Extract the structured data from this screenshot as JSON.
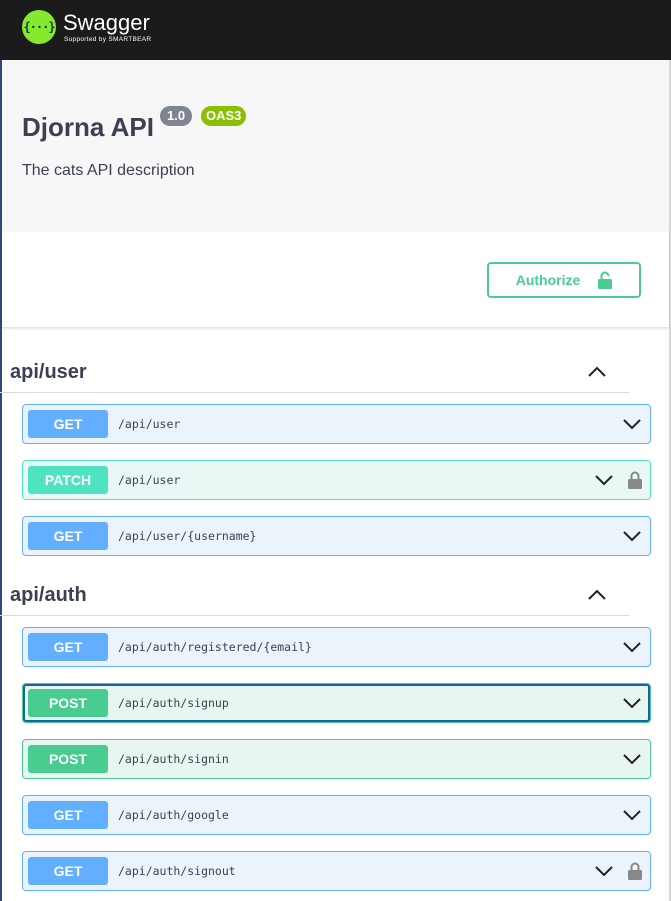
{
  "topbar": {
    "logo_glyph": "{···}",
    "logo_name": "Swagger",
    "logo_sub": "Supported by SMARTBEAR"
  },
  "info": {
    "title": "Djorna API",
    "version": "1.0",
    "oas": "OAS3",
    "description": "The cats API description"
  },
  "scheme": {
    "authorize_label": "Authorize"
  },
  "sections": [
    {
      "title": "api/user",
      "operations": [
        {
          "method": "GET",
          "path": "/api/user"
        },
        {
          "method": "PATCH",
          "path": "/api/user",
          "locked": true
        },
        {
          "method": "GET",
          "path": "/api/user/{username}"
        }
      ]
    },
    {
      "title": "api/auth",
      "operations": [
        {
          "method": "GET",
          "path": "/api/auth/registered/{email}"
        },
        {
          "method": "POST",
          "path": "/api/auth/signup",
          "focused": true
        },
        {
          "method": "POST",
          "path": "/api/auth/signin"
        },
        {
          "method": "GET",
          "path": "/api/auth/google"
        },
        {
          "method": "GET",
          "path": "/api/auth/signout",
          "locked": true
        }
      ]
    }
  ],
  "colors": {
    "get": "#61affe",
    "post": "#49cc90",
    "patch": "#50e3c2",
    "accent": "#85ea2d"
  },
  "icons": {
    "collapse": "chevron-up-icon",
    "expand": "chevron-down-icon",
    "lock": "lock-icon",
    "unlocked": "unlocked-icon"
  }
}
